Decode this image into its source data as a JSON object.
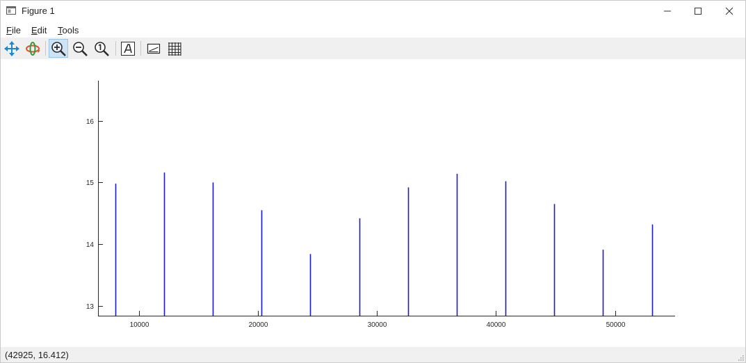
{
  "window": {
    "title": "Figure 1"
  },
  "menubar": {
    "items": [
      {
        "accel": "F",
        "rest": "ile"
      },
      {
        "accel": "E",
        "rest": "dit"
      },
      {
        "accel": "T",
        "rest": "ools"
      }
    ]
  },
  "toolbar": {
    "buttons": [
      {
        "icon": "pan-icon",
        "active": false
      },
      {
        "icon": "rotate-icon",
        "active": false
      },
      {
        "icon": "zoom-in-icon",
        "active": true
      },
      {
        "icon": "zoom-out-icon",
        "active": false
      },
      {
        "icon": "zoom-reset-icon",
        "active": false
      },
      {
        "icon": "text-icon",
        "active": false
      },
      {
        "icon": "legend-icon",
        "active": false
      },
      {
        "icon": "grid-icon",
        "active": false
      }
    ]
  },
  "status": {
    "coordinates": "(42925, 16.412)"
  },
  "colors": {
    "stem": "#1a1acf",
    "axis": "#262626",
    "toolbar_bg": "#f0f0f0",
    "active_button": "#cfe3f6"
  },
  "chart_data": {
    "type": "bar",
    "style": "stem",
    "title": "",
    "xlabel": "",
    "ylabel": "",
    "x": [
      8000,
      12100,
      16200,
      20300,
      24400,
      28500,
      32600,
      36700,
      40800,
      44900,
      49000,
      53100
    ],
    "values": [
      14.98,
      15.16,
      15.0,
      14.55,
      13.84,
      14.42,
      14.92,
      15.14,
      15.02,
      14.65,
      13.91,
      14.32
    ],
    "xlim": [
      6550,
      55050
    ],
    "ylim": [
      12.84,
      16.65
    ],
    "xticks": [
      10000,
      20000,
      30000,
      40000,
      50000
    ],
    "xtick_labels": [
      "10000",
      "20000",
      "30000",
      "40000",
      "50000"
    ],
    "yticks": [
      13,
      14,
      15,
      16
    ],
    "ytick_labels": [
      "13",
      "14",
      "15",
      "16"
    ],
    "grid": false,
    "legend": "none"
  }
}
